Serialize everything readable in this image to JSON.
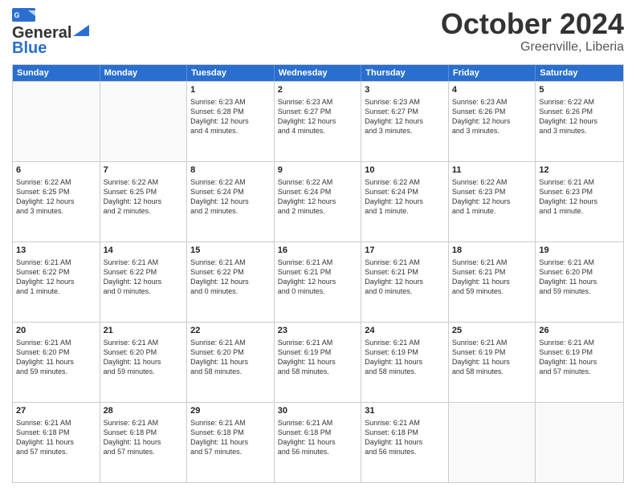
{
  "header": {
    "logo_line1": "General",
    "logo_line2": "Blue",
    "month": "October 2024",
    "location": "Greenville, Liberia"
  },
  "weekdays": [
    "Sunday",
    "Monday",
    "Tuesday",
    "Wednesday",
    "Thursday",
    "Friday",
    "Saturday"
  ],
  "rows": [
    [
      {
        "day": "",
        "lines": [],
        "empty": true
      },
      {
        "day": "",
        "lines": [],
        "empty": true
      },
      {
        "day": "1",
        "lines": [
          "Sunrise: 6:23 AM",
          "Sunset: 6:28 PM",
          "Daylight: 12 hours",
          "and 4 minutes."
        ]
      },
      {
        "day": "2",
        "lines": [
          "Sunrise: 6:23 AM",
          "Sunset: 6:27 PM",
          "Daylight: 12 hours",
          "and 4 minutes."
        ]
      },
      {
        "day": "3",
        "lines": [
          "Sunrise: 6:23 AM",
          "Sunset: 6:27 PM",
          "Daylight: 12 hours",
          "and 3 minutes."
        ]
      },
      {
        "day": "4",
        "lines": [
          "Sunrise: 6:23 AM",
          "Sunset: 6:26 PM",
          "Daylight: 12 hours",
          "and 3 minutes."
        ]
      },
      {
        "day": "5",
        "lines": [
          "Sunrise: 6:22 AM",
          "Sunset: 6:26 PM",
          "Daylight: 12 hours",
          "and 3 minutes."
        ]
      }
    ],
    [
      {
        "day": "6",
        "lines": [
          "Sunrise: 6:22 AM",
          "Sunset: 6:25 PM",
          "Daylight: 12 hours",
          "and 3 minutes."
        ]
      },
      {
        "day": "7",
        "lines": [
          "Sunrise: 6:22 AM",
          "Sunset: 6:25 PM",
          "Daylight: 12 hours",
          "and 2 minutes."
        ]
      },
      {
        "day": "8",
        "lines": [
          "Sunrise: 6:22 AM",
          "Sunset: 6:24 PM",
          "Daylight: 12 hours",
          "and 2 minutes."
        ]
      },
      {
        "day": "9",
        "lines": [
          "Sunrise: 6:22 AM",
          "Sunset: 6:24 PM",
          "Daylight: 12 hours",
          "and 2 minutes."
        ]
      },
      {
        "day": "10",
        "lines": [
          "Sunrise: 6:22 AM",
          "Sunset: 6:24 PM",
          "Daylight: 12 hours",
          "and 1 minute."
        ]
      },
      {
        "day": "11",
        "lines": [
          "Sunrise: 6:22 AM",
          "Sunset: 6:23 PM",
          "Daylight: 12 hours",
          "and 1 minute."
        ]
      },
      {
        "day": "12",
        "lines": [
          "Sunrise: 6:21 AM",
          "Sunset: 6:23 PM",
          "Daylight: 12 hours",
          "and 1 minute."
        ]
      }
    ],
    [
      {
        "day": "13",
        "lines": [
          "Sunrise: 6:21 AM",
          "Sunset: 6:22 PM",
          "Daylight: 12 hours",
          "and 1 minute."
        ]
      },
      {
        "day": "14",
        "lines": [
          "Sunrise: 6:21 AM",
          "Sunset: 6:22 PM",
          "Daylight: 12 hours",
          "and 0 minutes."
        ]
      },
      {
        "day": "15",
        "lines": [
          "Sunrise: 6:21 AM",
          "Sunset: 6:22 PM",
          "Daylight: 12 hours",
          "and 0 minutes."
        ]
      },
      {
        "day": "16",
        "lines": [
          "Sunrise: 6:21 AM",
          "Sunset: 6:21 PM",
          "Daylight: 12 hours",
          "and 0 minutes."
        ]
      },
      {
        "day": "17",
        "lines": [
          "Sunrise: 6:21 AM",
          "Sunset: 6:21 PM",
          "Daylight: 12 hours",
          "and 0 minutes."
        ]
      },
      {
        "day": "18",
        "lines": [
          "Sunrise: 6:21 AM",
          "Sunset: 6:21 PM",
          "Daylight: 11 hours",
          "and 59 minutes."
        ]
      },
      {
        "day": "19",
        "lines": [
          "Sunrise: 6:21 AM",
          "Sunset: 6:20 PM",
          "Daylight: 11 hours",
          "and 59 minutes."
        ]
      }
    ],
    [
      {
        "day": "20",
        "lines": [
          "Sunrise: 6:21 AM",
          "Sunset: 6:20 PM",
          "Daylight: 11 hours",
          "and 59 minutes."
        ]
      },
      {
        "day": "21",
        "lines": [
          "Sunrise: 6:21 AM",
          "Sunset: 6:20 PM",
          "Daylight: 11 hours",
          "and 59 minutes."
        ]
      },
      {
        "day": "22",
        "lines": [
          "Sunrise: 6:21 AM",
          "Sunset: 6:20 PM",
          "Daylight: 11 hours",
          "and 58 minutes."
        ]
      },
      {
        "day": "23",
        "lines": [
          "Sunrise: 6:21 AM",
          "Sunset: 6:19 PM",
          "Daylight: 11 hours",
          "and 58 minutes."
        ]
      },
      {
        "day": "24",
        "lines": [
          "Sunrise: 6:21 AM",
          "Sunset: 6:19 PM",
          "Daylight: 11 hours",
          "and 58 minutes."
        ]
      },
      {
        "day": "25",
        "lines": [
          "Sunrise: 6:21 AM",
          "Sunset: 6:19 PM",
          "Daylight: 11 hours",
          "and 58 minutes."
        ]
      },
      {
        "day": "26",
        "lines": [
          "Sunrise: 6:21 AM",
          "Sunset: 6:19 PM",
          "Daylight: 11 hours",
          "and 57 minutes."
        ]
      }
    ],
    [
      {
        "day": "27",
        "lines": [
          "Sunrise: 6:21 AM",
          "Sunset: 6:18 PM",
          "Daylight: 11 hours",
          "and 57 minutes."
        ]
      },
      {
        "day": "28",
        "lines": [
          "Sunrise: 6:21 AM",
          "Sunset: 6:18 PM",
          "Daylight: 11 hours",
          "and 57 minutes."
        ]
      },
      {
        "day": "29",
        "lines": [
          "Sunrise: 6:21 AM",
          "Sunset: 6:18 PM",
          "Daylight: 11 hours",
          "and 57 minutes."
        ]
      },
      {
        "day": "30",
        "lines": [
          "Sunrise: 6:21 AM",
          "Sunset: 6:18 PM",
          "Daylight: 11 hours",
          "and 56 minutes."
        ]
      },
      {
        "day": "31",
        "lines": [
          "Sunrise: 6:21 AM",
          "Sunset: 6:18 PM",
          "Daylight: 11 hours",
          "and 56 minutes."
        ]
      },
      {
        "day": "",
        "lines": [],
        "empty": true
      },
      {
        "day": "",
        "lines": [],
        "empty": true
      }
    ]
  ]
}
